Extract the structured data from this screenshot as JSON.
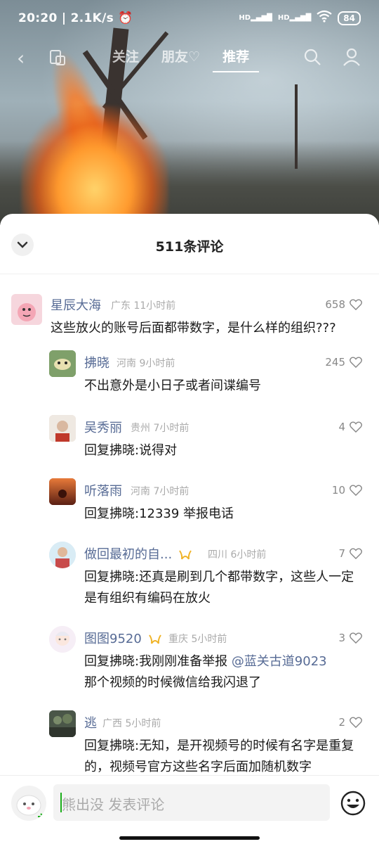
{
  "status_bar": {
    "time": "20:20",
    "net_speed": "2.1K/s",
    "signal1": "HD",
    "signal2": "HD",
    "battery": "84"
  },
  "top_nav": {
    "tabs": [
      {
        "label": "关注",
        "active": false
      },
      {
        "label": "朋友",
        "active": false
      },
      {
        "label": "推荐",
        "active": true
      }
    ]
  },
  "comments_panel": {
    "title": "511条评论"
  },
  "comments": [
    {
      "name": "星辰大海",
      "location": "广东",
      "time": "11小时前",
      "likes": "658",
      "text": "这些放火的账号后面都带数字，是什么样的组织???"
    },
    {
      "name": "拂晓",
      "location": "河南",
      "time": "9小时前",
      "likes": "245",
      "text": "不出意外是小日子或者间谍编号"
    },
    {
      "name": "吴秀丽",
      "location": "贵州",
      "time": "7小时前",
      "likes": "4",
      "reply_prefix": "回复拂晓:",
      "text": "说得对"
    },
    {
      "name": "听落雨",
      "location": "河南",
      "time": "7小时前",
      "likes": "10",
      "reply_prefix": "回复拂晓:",
      "text": "12339 举报电话"
    },
    {
      "name": "做回最初的自...",
      "location": "四川",
      "time": "6小时前",
      "likes": "7",
      "reply_prefix": "回复拂晓:",
      "text": "还真是刷到几个都带数字，这些人一定是有组织有编码在放火"
    },
    {
      "name": "图图9520",
      "location": "重庆",
      "time": "5小时前",
      "likes": "3",
      "reply_prefix": "回复拂晓:",
      "text_before": "我刚刚准备举报",
      "mention": "@蓝关古道9023",
      "text_after": "那个视频的时候微信给我闪退了"
    },
    {
      "name": "逃",
      "location": "广西",
      "time": "5小时前",
      "likes": "2",
      "reply_prefix": "回复拂晓:",
      "text": "无知，是开视频号的时候有名字是重复的，视频号官方这些名字后面加随机数字"
    }
  ],
  "input_bar": {
    "placeholder": "熊出没 发表评论"
  },
  "colors": {
    "link": "#576b95",
    "meta": "#aaaaaa",
    "vip_badge": "#f0b429"
  }
}
